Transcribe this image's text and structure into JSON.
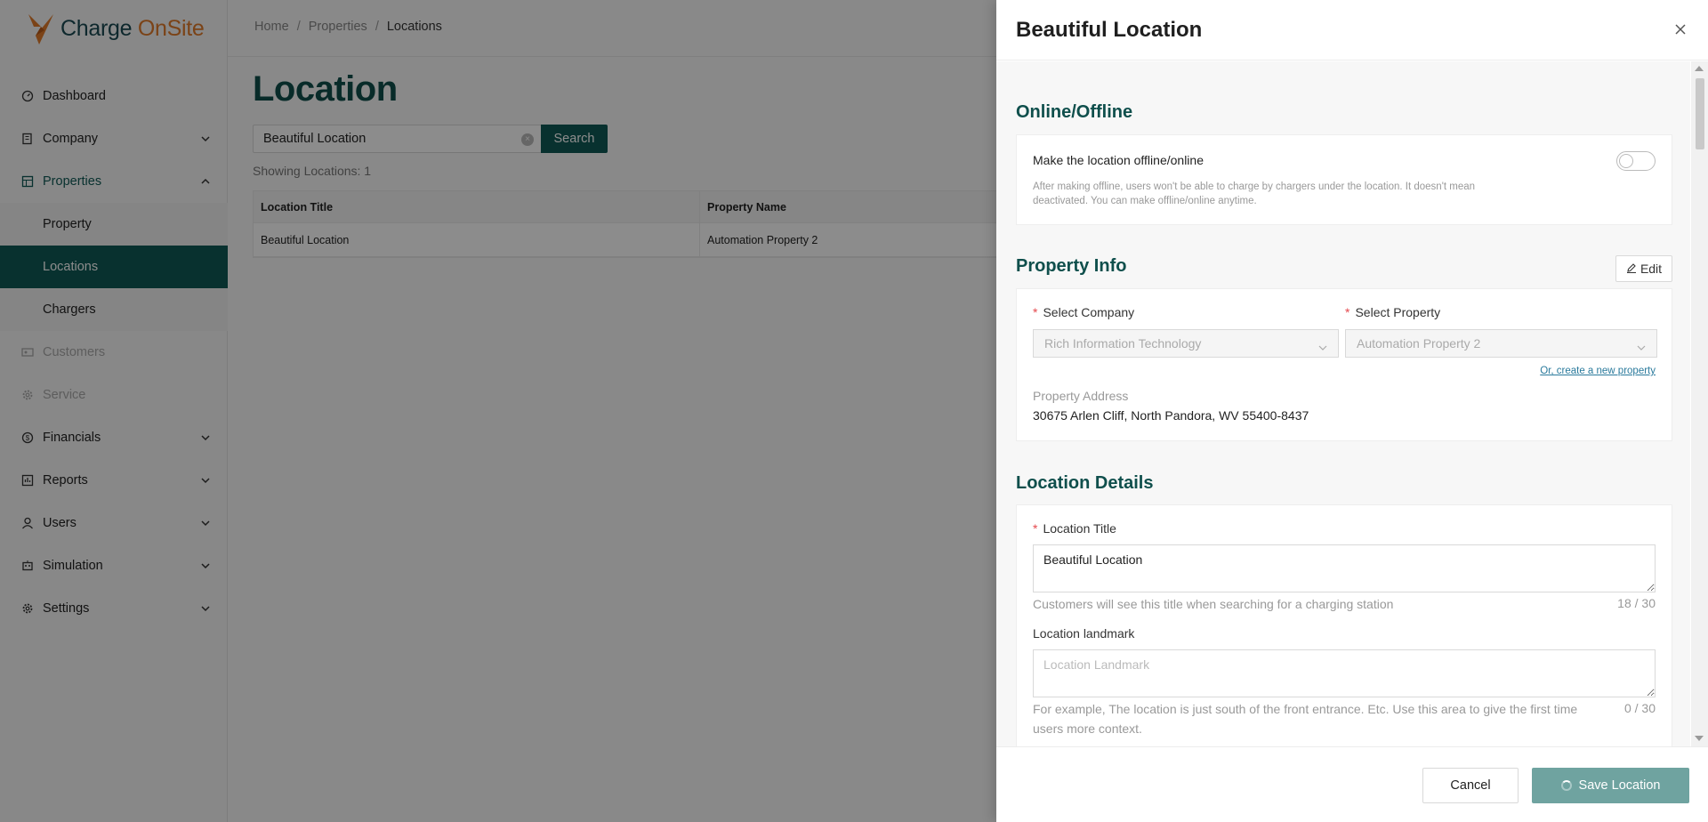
{
  "app": {
    "logo_part1": "Charge",
    "logo_part2": "OnSite",
    "breadcrumb": [
      "Home",
      "Properties",
      "Locations"
    ]
  },
  "sidebar": {
    "items": [
      {
        "label": "Dashboard",
        "icon": "dashboard-icon"
      },
      {
        "label": "Company",
        "icon": "building-icon",
        "expand": "chevron-down-icon"
      },
      {
        "label": "Properties",
        "icon": "grid-icon",
        "expand": "chevron-up-icon"
      },
      {
        "label": "Property"
      },
      {
        "label": "Locations"
      },
      {
        "label": "Chargers"
      },
      {
        "label": "Customers",
        "icon": "id-card-icon"
      },
      {
        "label": "Service",
        "icon": "gear-icon"
      },
      {
        "label": "Financials",
        "icon": "dollar-icon",
        "expand": "chevron-down-icon"
      },
      {
        "label": "Reports",
        "icon": "report-icon",
        "expand": "chevron-down-icon"
      },
      {
        "label": "Users",
        "icon": "user-icon",
        "expand": "chevron-down-icon"
      },
      {
        "label": "Simulation",
        "icon": "robot-icon",
        "expand": "chevron-down-icon"
      },
      {
        "label": "Settings",
        "icon": "gear-icon",
        "expand": "chevron-down-icon"
      }
    ]
  },
  "main": {
    "title": "Location",
    "search_value": "Beautiful Location",
    "search_button": "Search",
    "showing": "Showing Locations: 1",
    "table": {
      "headers": [
        "Location Title",
        "Property Name"
      ],
      "rows": [
        [
          "Beautiful Location",
          "Automation Property 2"
        ]
      ]
    }
  },
  "drawer": {
    "title": "Beautiful Location",
    "online_section": "Online/Offline",
    "toggle_label": "Make the location offline/online",
    "toggle_desc": "After making offline, users won't be able to charge by chargers under the location. It doesn't mean deactivated. You can make offline/online anytime.",
    "property_section": "Property Info",
    "edit_label": "Edit",
    "company_label": "Select Company",
    "company_value": "Rich Information Technology",
    "property_label": "Select Property",
    "property_value": "Automation Property 2",
    "create_link": "Or, create a new property",
    "address_label": "Property Address",
    "address_value": "30675 Arlen Cliff, North Pandora, WV 55400-8437",
    "details_section": "Location Details",
    "title_label": "Location Title",
    "title_value": "Beautiful Location",
    "title_helper": "Customers will see this title when searching for a charging station",
    "title_counter": "18 / 30",
    "landmark_label": "Location landmark",
    "landmark_placeholder": "Location Landmark",
    "landmark_helper": "For example, The location is just south of the front entrance. Etc. Use this area to give the first time users more context.",
    "landmark_counter": "0 / 30",
    "cancel_label": "Cancel",
    "save_label": "Save Location"
  },
  "colors": {
    "brand_teal": "#0f5a56",
    "brand_orange": "#e07a2a",
    "section_title": "#0f4f4c",
    "save_disabled": "#6fa3a0"
  }
}
